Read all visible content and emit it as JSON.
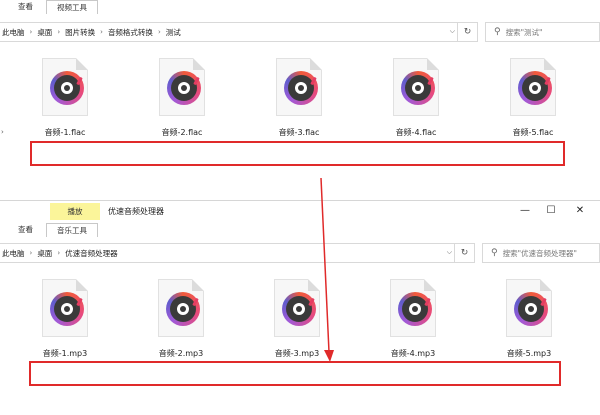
{
  "window1": {
    "tabs": [
      "查看",
      "视频工具"
    ],
    "breadcrumb": [
      "此电脑",
      "桌面",
      "图片转换",
      "音频格式转换",
      "测试"
    ],
    "search_placeholder": "搜索\"测试\"",
    "files": [
      "音频-1.flac",
      "音频-2.flac",
      "音频-3.flac",
      "音频-4.flac",
      "音频-5.flac"
    ]
  },
  "window2": {
    "play_tab": "播放",
    "title": "优速音频处理器",
    "tabs": [
      "查看",
      "音乐工具"
    ],
    "breadcrumb": [
      "此电脑",
      "桌面",
      "优速音频处理器"
    ],
    "search_placeholder": "搜索\"优速音频处理器\"",
    "files": [
      "音频-1.mp3",
      "音频-2.mp3",
      "音频-3.mp3",
      "音频-4.mp3",
      "音频-5.mp3"
    ],
    "controls": {
      "minimize": "—",
      "maximize": "☐",
      "close": "✕"
    }
  },
  "icons": {
    "refresh": "↻",
    "dropdown": "⌵",
    "search": "⚲",
    "separator": "›"
  },
  "colors": {
    "highlight_box": "#e02a2a",
    "arrow": "#e02a2a",
    "play_tab_bg": "#fbf59a"
  }
}
